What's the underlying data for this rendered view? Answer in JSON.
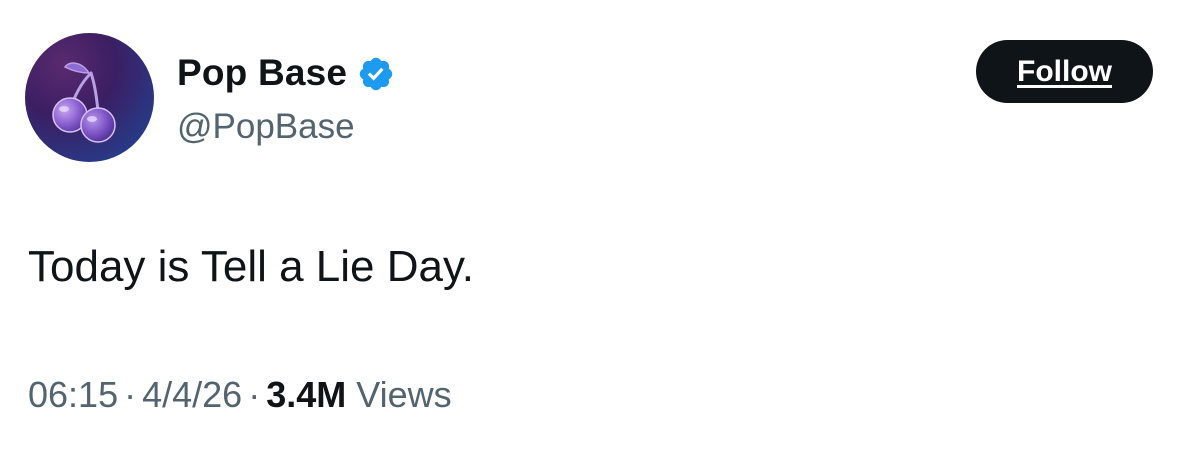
{
  "author": {
    "display_name": "Pop Base",
    "handle": "@PopBase",
    "verified": true,
    "avatar_icon": "cherry-icon",
    "verified_icon": "verified-badge-icon"
  },
  "follow_button": {
    "label": "Follow"
  },
  "tweet": {
    "text": "Today is Tell a Lie Day.",
    "time": "06:15",
    "date": "4/4/26",
    "views_count": "3.4M",
    "views_label": "Views",
    "separator": "·"
  },
  "colors": {
    "text_primary": "#0f1419",
    "text_secondary": "#536471",
    "verified_blue": "#1d9bf0",
    "follow_bg": "#0f1419",
    "follow_text": "#ffffff",
    "avatar_bg_start": "#3b1e63",
    "avatar_bg_end": "#2a3f8f"
  }
}
